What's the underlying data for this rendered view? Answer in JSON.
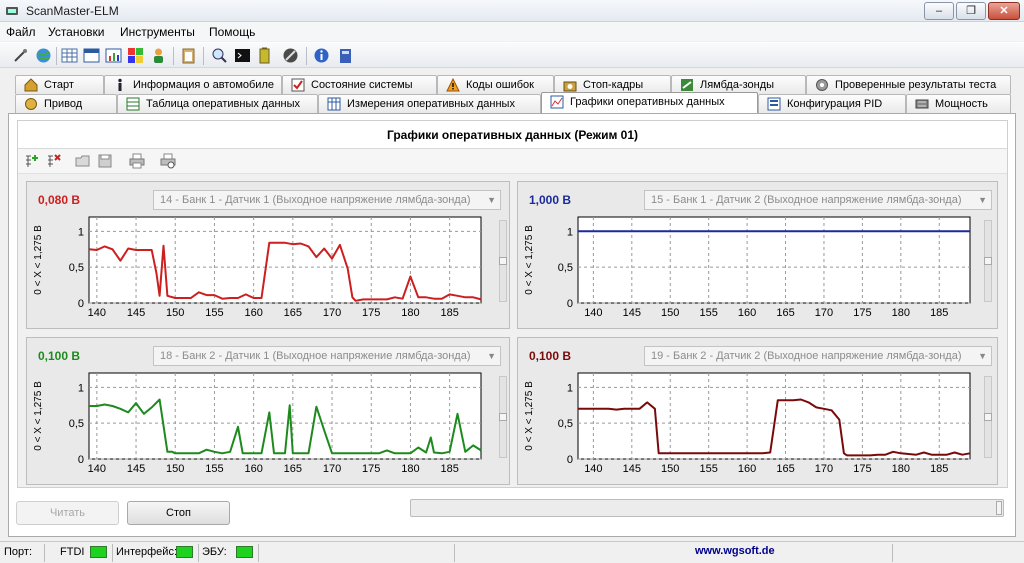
{
  "window": {
    "title": "ScanMaster-ELM",
    "minimize": "–",
    "maximize": "❐",
    "close": "✕"
  },
  "menu": [
    "Файл",
    "Установки",
    "Инструменты",
    "Помощь"
  ],
  "toolbar_icons": [
    "connect-icon",
    "globe-icon",
    "grid-icon",
    "chart-icon",
    "colors-icon",
    "person-icon",
    "clipboard-icon",
    "search-icon",
    "terminal-icon",
    "record-icon",
    "info-icon",
    "book-icon"
  ],
  "tabs_row1": [
    {
      "label": "Старт",
      "icon": "home-icon"
    },
    {
      "label": "Информация о автомобиле",
      "icon": "info-icon"
    },
    {
      "label": "Состояние системы",
      "icon": "check-icon"
    },
    {
      "label": "Коды ошибок",
      "icon": "warning-icon"
    },
    {
      "label": "Стоп-кадры",
      "icon": "camera-icon"
    },
    {
      "label": "Лямбда-зонды",
      "icon": "sensor-icon"
    },
    {
      "label": "Проверенные результаты теста",
      "icon": "gear-icon"
    }
  ],
  "tabs_row2": [
    {
      "label": "Привод",
      "icon": "drive-icon"
    },
    {
      "label": "Таблица оперативных данных",
      "icon": "table-icon"
    },
    {
      "label": "Измерения оперативных данных",
      "icon": "measure-icon"
    },
    {
      "label": "Графики оперативных данных",
      "icon": "graph-icon",
      "active": true
    },
    {
      "label": "Конфигурация PID",
      "icon": "config-icon"
    },
    {
      "label": "Мощность",
      "icon": "power-icon"
    }
  ],
  "graph_title": "Графики оперативных данных (Режим 01)",
  "inner_toolbar_icons": [
    "add-graph-icon",
    "remove-graph-icon",
    "open-icon",
    "save-icon",
    "print-icon",
    "print-preview-icon"
  ],
  "charts": [
    {
      "value": "0,080 В",
      "selector": "14 - Банк 1 - Датчик 1 (Выходное напряжение лямбда-зонда)"
    },
    {
      "value": "1,000 В",
      "selector": "15 - Банк 1 - Датчик 2 (Выходное напряжение лямбда-зонда)"
    },
    {
      "value": "0,100 В",
      "selector": "18 - Банк 2 - Датчик 1 (Выходное напряжение лямбда-зонда)"
    },
    {
      "value": "0,100 В",
      "selector": "19 - Банк 2 - Датчик 2 (Выходное напряжение лямбда-зонда)"
    }
  ],
  "chart_data": [
    {
      "type": "line",
      "ylabel": "0 < X < 1,275 В",
      "xlim": [
        139,
        189
      ],
      "ylim": [
        0,
        1.2
      ],
      "xticks": [
        140,
        145,
        150,
        155,
        160,
        165,
        170,
        175,
        180,
        185
      ],
      "yticks": [
        0,
        0.5,
        1
      ],
      "ytick_labels": [
        "0",
        "0,5",
        "1"
      ],
      "grid": true,
      "color": "#cc1f1f",
      "series": [
        {
          "x": [
            139,
            140,
            141,
            142,
            143,
            144,
            145,
            146,
            147,
            147.6,
            148,
            148.5,
            149,
            150,
            151,
            152,
            153,
            154,
            155,
            156,
            157,
            158,
            159,
            160,
            161,
            162,
            163,
            164,
            165,
            166,
            167,
            168,
            169,
            170,
            171,
            172,
            172.6,
            173,
            174,
            175,
            176,
            177,
            178,
            179,
            180,
            181,
            182,
            183,
            184,
            185,
            186,
            187,
            188,
            189
          ],
          "y": [
            0.75,
            0.74,
            0.79,
            0.75,
            0.59,
            0.76,
            0.74,
            0.74,
            0.74,
            0.42,
            0.1,
            0.8,
            0.1,
            0.07,
            0.07,
            0.07,
            0.15,
            0.11,
            0.11,
            0.06,
            0.07,
            0.07,
            0.12,
            0.07,
            0.07,
            0.84,
            0.84,
            0.84,
            0.82,
            0.83,
            0.79,
            0.64,
            0.76,
            0.62,
            0.81,
            0.48,
            0.08,
            0.03,
            0.05,
            0.05,
            0.05,
            0.05,
            0.08,
            0.06,
            0.37,
            0.08,
            0.08,
            0.06,
            0.06,
            0.12,
            0.1,
            0.08,
            0.08,
            0.05
          ]
        }
      ]
    },
    {
      "type": "line",
      "ylabel": "0 < X < 1,275 В",
      "xlim": [
        138,
        189
      ],
      "ylim": [
        0,
        1.2
      ],
      "xticks": [
        140,
        145,
        150,
        155,
        160,
        165,
        170,
        175,
        180,
        185
      ],
      "yticks": [
        0,
        0.5,
        1
      ],
      "ytick_labels": [
        "0",
        "0,5",
        "1"
      ],
      "grid": true,
      "color": "#1a2a9c",
      "series": [
        {
          "x": [
            138,
            189
          ],
          "y": [
            1.0,
            1.0
          ]
        }
      ]
    },
    {
      "type": "line",
      "ylabel": "0 < X < 1,275 В",
      "xlim": [
        139,
        189
      ],
      "ylim": [
        0,
        1.2
      ],
      "xticks": [
        140,
        145,
        150,
        155,
        160,
        165,
        170,
        175,
        180,
        185
      ],
      "yticks": [
        0,
        0.5,
        1
      ],
      "ytick_labels": [
        "0",
        "0,5",
        "1"
      ],
      "grid": true,
      "color": "#1e8a1e",
      "series": [
        {
          "x": [
            139,
            140,
            141,
            142,
            143,
            144,
            145,
            146,
            147,
            148,
            149,
            149.6,
            150,
            151,
            152,
            153,
            154,
            155,
            156,
            157,
            158,
            158.6,
            159,
            160,
            161,
            162,
            162.6,
            163,
            164,
            164.6,
            165,
            166,
            167,
            168,
            169,
            170,
            171,
            172,
            173,
            174,
            175,
            176,
            177,
            178,
            179,
            180,
            181,
            182,
            182.6,
            183,
            184,
            185,
            186,
            187,
            188,
            189
          ],
          "y": [
            0.74,
            0.74,
            0.76,
            0.74,
            0.7,
            0.65,
            0.78,
            0.63,
            0.72,
            0.83,
            0.1,
            0.1,
            0.08,
            0.08,
            0.08,
            0.08,
            0.13,
            0.1,
            0.08,
            0.1,
            0.45,
            0.08,
            0.08,
            0.08,
            0.08,
            0.65,
            0.08,
            0.08,
            0.08,
            0.75,
            0.08,
            0.08,
            0.08,
            0.73,
            0.4,
            0.08,
            0.08,
            0.08,
            0.08,
            0.08,
            0.08,
            0.08,
            0.12,
            0.08,
            0.08,
            0.08,
            0.16,
            0.09,
            0.3,
            0.09,
            0.08,
            0.1,
            0.63,
            0.1,
            0.19,
            0.12
          ]
        }
      ]
    },
    {
      "type": "line",
      "ylabel": "0 < X < 1,275 В",
      "xlim": [
        138,
        189
      ],
      "ylim": [
        0,
        1.2
      ],
      "xticks": [
        140,
        145,
        150,
        155,
        160,
        165,
        170,
        175,
        180,
        185
      ],
      "yticks": [
        0,
        0.5,
        1
      ],
      "ytick_labels": [
        "0",
        "0,5",
        "1"
      ],
      "grid": true,
      "color": "#7a0a0a",
      "series": [
        {
          "x": [
            138,
            139,
            140,
            141,
            142,
            143,
            144,
            145,
            146,
            147,
            148,
            148.5,
            149,
            150,
            151,
            152,
            153,
            154,
            155,
            156,
            157,
            158,
            159,
            160,
            161,
            162,
            163,
            164,
            165,
            166,
            167,
            168,
            169,
            170,
            171,
            172,
            172.6,
            173,
            174,
            175,
            176,
            177,
            178,
            179,
            180,
            181,
            182,
            183,
            184,
            185,
            186,
            187,
            188,
            189
          ],
          "y": [
            0.7,
            0.7,
            0.7,
            0.7,
            0.7,
            0.69,
            0.7,
            0.7,
            0.7,
            0.79,
            0.7,
            0.08,
            0.08,
            0.08,
            0.08,
            0.08,
            0.08,
            0.08,
            0.08,
            0.08,
            0.08,
            0.08,
            0.08,
            0.08,
            0.08,
            0.08,
            0.09,
            0.82,
            0.82,
            0.82,
            0.83,
            0.79,
            0.72,
            0.7,
            0.68,
            0.55,
            0.08,
            0.05,
            0.05,
            0.05,
            0.05,
            0.06,
            0.06,
            0.1,
            0.08,
            0.07,
            0.06,
            0.09,
            0.06,
            0.06,
            0.06,
            0.09,
            0.06,
            0.08
          ]
        }
      ]
    }
  ],
  "buttons": {
    "read": "Читать",
    "stop": "Стоп"
  },
  "status": {
    "port_label": "Порт:",
    "port_value": "FTDI",
    "interface_label": "Интерфейс:",
    "ecu_label": "ЭБУ:",
    "link": "www.wgsoft.de",
    "led_color": "#1ed31e"
  }
}
